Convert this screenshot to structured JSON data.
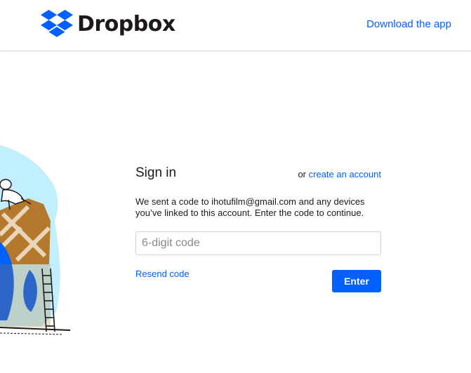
{
  "header": {
    "brand": "Dropbox",
    "download_link": "Download the app"
  },
  "signin": {
    "title": "Sign in",
    "or_text": "or",
    "create_account": "create an account",
    "message": "We sent a code to ihotufilm@gmail.com and any devices you’ve linked to this account. Enter the code to continue.",
    "code_placeholder": "6-digit code",
    "resend": "Resend code",
    "enter": "Enter"
  },
  "colors": {
    "accent": "#0061fe",
    "text": "#1e1919",
    "border": "#d4d1cc"
  },
  "icons": {
    "logo": "dropbox-logo-icon"
  }
}
